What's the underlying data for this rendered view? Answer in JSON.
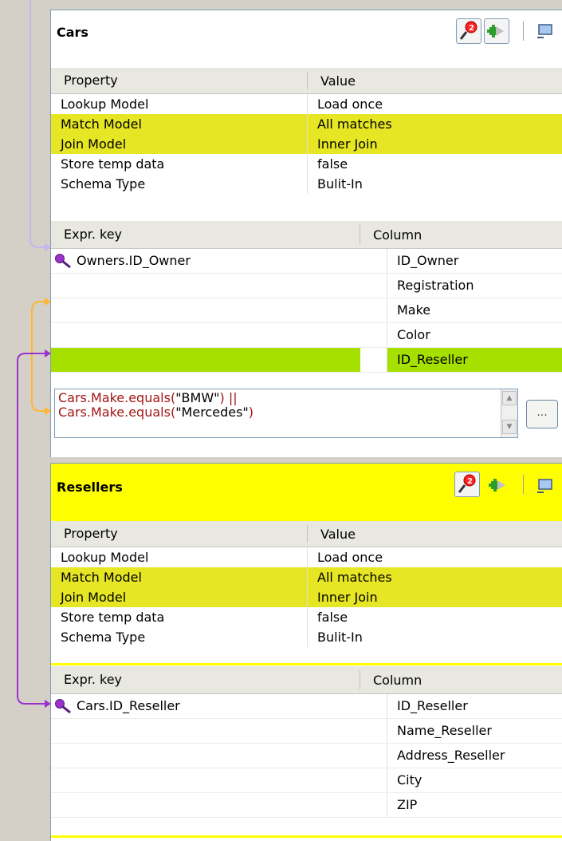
{
  "cars": {
    "title": "Cars",
    "props_header": {
      "property": "Property",
      "value": "Value"
    },
    "props": [
      {
        "property": "Lookup Model",
        "value": "Load once",
        "highlight": false
      },
      {
        "property": "Match Model",
        "value": "All matches",
        "highlight": true
      },
      {
        "property": "Join Model",
        "value": "Inner Join",
        "highlight": true
      },
      {
        "property": "Store temp data",
        "value": "false",
        "highlight": false
      },
      {
        "property": "Schema Type",
        "value": "Bulit-In",
        "highlight": false
      }
    ],
    "keys_header": {
      "expr": "Expr. key",
      "column": "Column"
    },
    "keys": [
      {
        "expr": "Owners.ID_Owner",
        "column": "ID_Owner"
      },
      {
        "expr": "",
        "column": "Registration"
      },
      {
        "expr": "",
        "column": "Make"
      },
      {
        "expr": "",
        "column": "Color"
      },
      {
        "expr": "",
        "column": "ID_Reseller"
      }
    ],
    "filter": {
      "line1_a": "Cars.Make.equals(",
      "line1_q": "\"BMW\"",
      "line1_b": ") ||",
      "line2_a": "Cars.Make.equals(",
      "line2_q": "\"Mercedes\"",
      "line2_b": ")"
    },
    "ellipsis": "..."
  },
  "resellers": {
    "title": "Resellers",
    "props_header": {
      "property": "Property",
      "value": "Value"
    },
    "props": [
      {
        "property": "Lookup Model",
        "value": "Load once",
        "highlight": false
      },
      {
        "property": "Match Model",
        "value": "All matches",
        "highlight": true
      },
      {
        "property": "Join Model",
        "value": "Inner Join",
        "highlight": true
      },
      {
        "property": "Store temp data",
        "value": "false",
        "highlight": false
      },
      {
        "property": "Schema Type",
        "value": "Bulit-In",
        "highlight": false
      }
    ],
    "keys_header": {
      "expr": "Expr. key",
      "column": "Column"
    },
    "keys": [
      {
        "expr": "Cars.ID_Reseller",
        "column": "ID_Reseller"
      },
      {
        "expr": "",
        "column": "Name_Reseller"
      },
      {
        "expr": "",
        "column": "Address_Reseller"
      },
      {
        "expr": "",
        "column": "City"
      },
      {
        "expr": "",
        "column": "ZIP"
      }
    ]
  },
  "colors": {
    "highlight_yellow": "#e6e624",
    "title_yellow": "#ffff00",
    "link_green": "#a6e000",
    "link_purple": "#9a32cd",
    "link_orange": "#ffb732",
    "link_lilac": "#c8b4f0"
  }
}
